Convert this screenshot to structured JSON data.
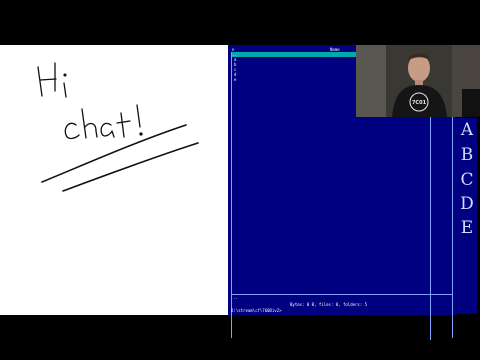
{
  "whiteboard": {
    "handwriting": [
      "Hi",
      "chat!"
    ]
  },
  "file_manager": {
    "header": {
      "left": "n",
      "title": "Name"
    },
    "selected_row": "..",
    "rows": [
      "a",
      "b",
      "c",
      "d",
      "e"
    ],
    "prompt": "..",
    "status": "Bytes: 0 B, files: 0, folders: 5",
    "command_line": "D:\\stream\\cf\\760Div2>"
  },
  "side_letters": [
    "A",
    "B",
    "C",
    "D",
    "E"
  ],
  "webcam": {
    "shirt_text": "7C01"
  },
  "colors": {
    "panel_bg": "#000080",
    "selection": "#00aaaa",
    "border": "#7fa2ff",
    "whiteboard": "#ffffff"
  }
}
